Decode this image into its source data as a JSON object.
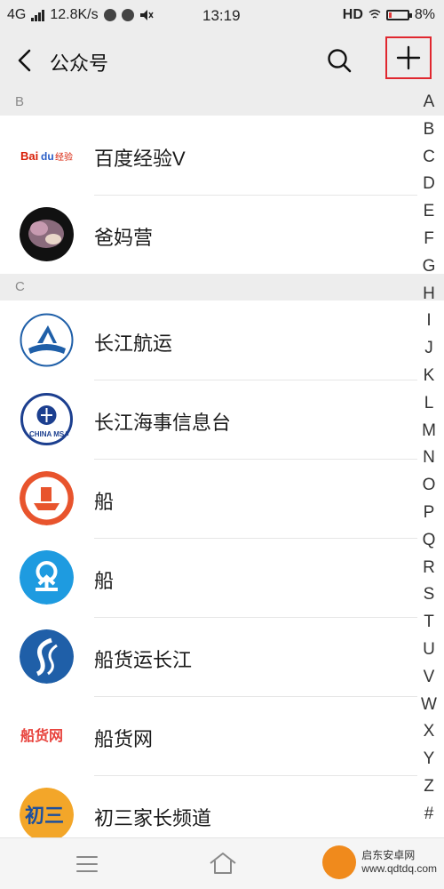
{
  "status_bar": {
    "network": "4G",
    "speed": "12.8K/s",
    "time": "13:19",
    "hd": "HD",
    "battery": "8%",
    "battery_level": 0.08
  },
  "nav": {
    "title": "公众号"
  },
  "sections": [
    {
      "letter": "B",
      "items": [
        {
          "name": "百度经验V",
          "avatar_text": "Bai经验",
          "accent": "#d81e06"
        },
        {
          "name": "爸妈营",
          "avatar_text": "",
          "accent": "#6b4a5a"
        }
      ]
    },
    {
      "letter": "C",
      "items": [
        {
          "name": "长江航运",
          "avatar_text": "",
          "accent": "#1f5fa8"
        },
        {
          "name": "长江海事信息台",
          "avatar_text": "CHINA MSA",
          "accent": "#1c3f8f"
        },
        {
          "name": "船",
          "avatar_text": "",
          "accent": "#e8542d"
        },
        {
          "name": "船",
          "avatar_text": "",
          "accent": "#1e9be0"
        },
        {
          "name": "船货运长江",
          "avatar_text": "",
          "accent": "#1f5fa8"
        },
        {
          "name": "船货网",
          "avatar_text": "船货网",
          "accent": "#e8433d"
        },
        {
          "name": "初三家长频道",
          "avatar_text": "初三",
          "accent": "#f3a629"
        }
      ]
    }
  ],
  "alphabet_index": [
    "A",
    "B",
    "C",
    "D",
    "E",
    "F",
    "G",
    "H",
    "I",
    "J",
    "K",
    "L",
    "M",
    "N",
    "O",
    "P",
    "Q",
    "R",
    "S",
    "T",
    "U",
    "V",
    "W",
    "X",
    "Y",
    "Z",
    "#"
  ],
  "watermark": {
    "line1": "启东安卓网",
    "line2": "www.qdtdq.com"
  }
}
